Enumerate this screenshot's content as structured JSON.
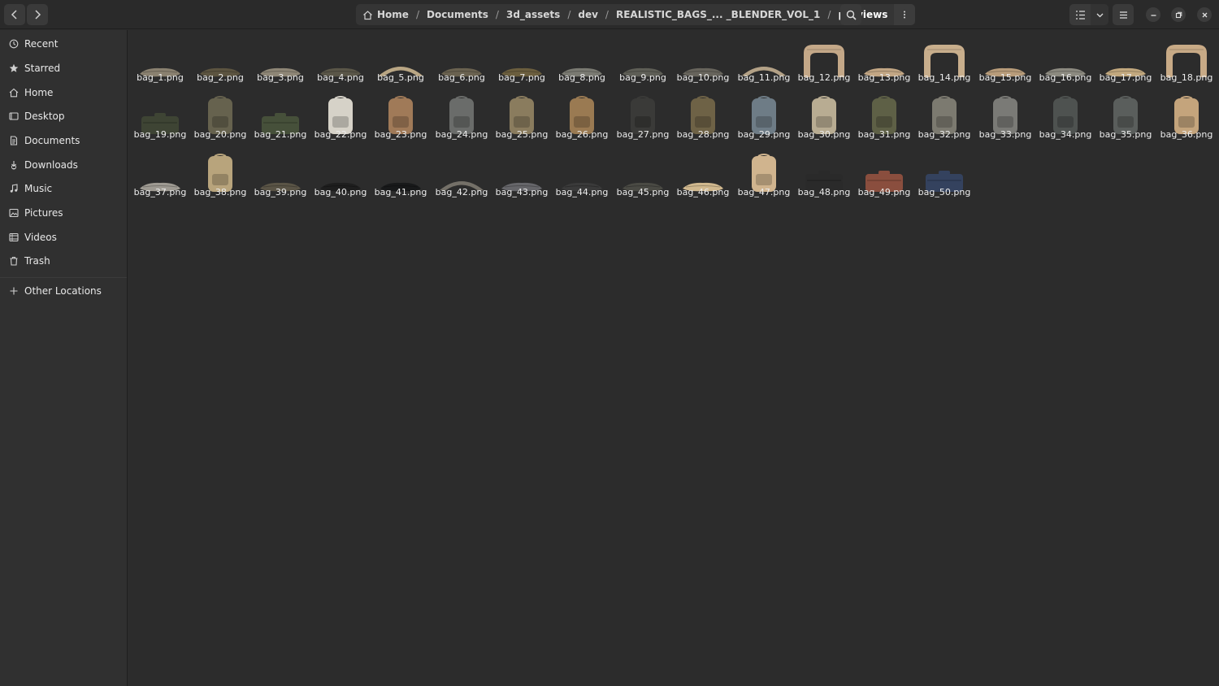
{
  "header": {
    "breadcrumb": [
      {
        "label": "Home",
        "icon": "home-icon"
      },
      {
        "label": "Documents"
      },
      {
        "label": "3d_assets"
      },
      {
        "label": "dev"
      },
      {
        "label": "REALISTIC_BAGS_... _BLENDER_VOL_1"
      },
      {
        "label": "previews"
      }
    ],
    "separator": "/",
    "buttons": [
      "back-icon",
      "forward-icon",
      "path-menu-icon",
      "search-icon",
      "list-view-icon",
      "view-options-chevron-icon",
      "hamburger-menu-icon",
      "minimize-icon",
      "maximize-icon",
      "close-icon"
    ]
  },
  "sidebar": {
    "items": [
      {
        "label": "Recent",
        "icon": "clock-icon"
      },
      {
        "label": "Starred",
        "icon": "star-icon"
      },
      {
        "label": "Home",
        "icon": "home-icon"
      },
      {
        "label": "Desktop",
        "icon": "desktop-icon"
      },
      {
        "label": "Documents",
        "icon": "document-icon"
      },
      {
        "label": "Downloads",
        "icon": "download-icon"
      },
      {
        "label": "Music",
        "icon": "music-icon"
      },
      {
        "label": "Pictures",
        "icon": "picture-icon"
      },
      {
        "label": "Videos",
        "icon": "video-icon"
      },
      {
        "label": "Trash",
        "icon": "trash-icon"
      },
      {
        "label": "Other Locations",
        "icon": "plus-icon"
      }
    ]
  },
  "files": [
    {
      "name": "bag_1.png",
      "shape": "flat",
      "color": "#8a8170"
    },
    {
      "name": "bag_2.png",
      "shape": "flat",
      "color": "#5c5440"
    },
    {
      "name": "bag_3.png",
      "shape": "flat",
      "color": "#8e8676"
    },
    {
      "name": "bag_4.png",
      "shape": "flat",
      "color": "#5a5648"
    },
    {
      "name": "bag_5.png",
      "shape": "arc",
      "color": "#b9a684"
    },
    {
      "name": "bag_6.png",
      "shape": "flat",
      "color": "#6a6250"
    },
    {
      "name": "bag_7.png",
      "shape": "flat",
      "color": "#6b5e3e"
    },
    {
      "name": "bag_8.png",
      "shape": "flat",
      "color": "#7a7a72"
    },
    {
      "name": "bag_9.png",
      "shape": "flat",
      "color": "#5e5e56"
    },
    {
      "name": "bag_10.png",
      "shape": "flat",
      "color": "#67645c"
    },
    {
      "name": "bag_11.png",
      "shape": "arc",
      "color": "#b3a186"
    },
    {
      "name": "bag_12.png",
      "shape": "arch",
      "color": "#c4a888"
    },
    {
      "name": "bag_13.png",
      "shape": "flat",
      "color": "#c2a684"
    },
    {
      "name": "bag_14.png",
      "shape": "arch",
      "color": "#c8ae8c"
    },
    {
      "name": "bag_15.png",
      "shape": "flat",
      "color": "#b89c7a"
    },
    {
      "name": "bag_16.png",
      "shape": "flat",
      "color": "#8c8a80"
    },
    {
      "name": "bag_17.png",
      "shape": "flat",
      "color": "#c2a87e"
    },
    {
      "name": "bag_18.png",
      "shape": "arch",
      "color": "#c8aa86"
    },
    {
      "name": "bag_19.png",
      "shape": "box",
      "color": "#3e4434"
    },
    {
      "name": "bag_20.png",
      "shape": "tall",
      "color": "#66624e"
    },
    {
      "name": "bag_21.png",
      "shape": "box",
      "color": "#46503a"
    },
    {
      "name": "bag_22.png",
      "shape": "tall",
      "color": "#d6d2c8"
    },
    {
      "name": "bag_23.png",
      "shape": "tall",
      "color": "#a07a58"
    },
    {
      "name": "bag_24.png",
      "shape": "tall",
      "color": "#6a6c6a"
    },
    {
      "name": "bag_25.png",
      "shape": "tall",
      "color": "#8a7c5e"
    },
    {
      "name": "bag_26.png",
      "shape": "tall",
      "color": "#9a7a52"
    },
    {
      "name": "bag_27.png",
      "shape": "tall",
      "color": "#3a3a38"
    },
    {
      "name": "bag_28.png",
      "shape": "tall",
      "color": "#6e6246"
    },
    {
      "name": "bag_29.png",
      "shape": "tall",
      "color": "#6e7c86"
    },
    {
      "name": "bag_30.png",
      "shape": "tall",
      "color": "#b8ac92"
    },
    {
      "name": "bag_31.png",
      "shape": "tall",
      "color": "#5e6046"
    },
    {
      "name": "bag_32.png",
      "shape": "tall",
      "color": "#7c7a70"
    },
    {
      "name": "bag_33.png",
      "shape": "tall",
      "color": "#7a7a76"
    },
    {
      "name": "bag_34.png",
      "shape": "tall",
      "color": "#4e5250"
    },
    {
      "name": "bag_35.png",
      "shape": "tall",
      "color": "#5a5e5c"
    },
    {
      "name": "bag_36.png",
      "shape": "tall",
      "color": "#c4a47c"
    },
    {
      "name": "bag_37.png",
      "shape": "flat",
      "color": "#9e9a92"
    },
    {
      "name": "bag_38.png",
      "shape": "tall",
      "color": "#b8a47c"
    },
    {
      "name": "bag_39.png",
      "shape": "flat",
      "color": "#5a5446"
    },
    {
      "name": "bag_40.png",
      "shape": "flat",
      "color": "#1e1e1e"
    },
    {
      "name": "bag_41.png",
      "shape": "flat",
      "color": "#18191a"
    },
    {
      "name": "bag_42.png",
      "shape": "arc",
      "color": "#747068"
    },
    {
      "name": "bag_43.png",
      "shape": "flat",
      "color": "#66666a"
    },
    {
      "name": "bag_44.png",
      "shape": "flat",
      "color": "#3a3a3a"
    },
    {
      "name": "bag_45.png",
      "shape": "flat",
      "color": "#4a4a44"
    },
    {
      "name": "bag_46.png",
      "shape": "flat",
      "color": "#d0b88e"
    },
    {
      "name": "bag_47.png",
      "shape": "tall",
      "color": "#d0b48e"
    },
    {
      "name": "bag_48.png",
      "shape": "box",
      "color": "#2a2a2a"
    },
    {
      "name": "bag_49.png",
      "shape": "box",
      "color": "#8a4e3e"
    },
    {
      "name": "bag_50.png",
      "shape": "box",
      "color": "#34425e"
    }
  ]
}
